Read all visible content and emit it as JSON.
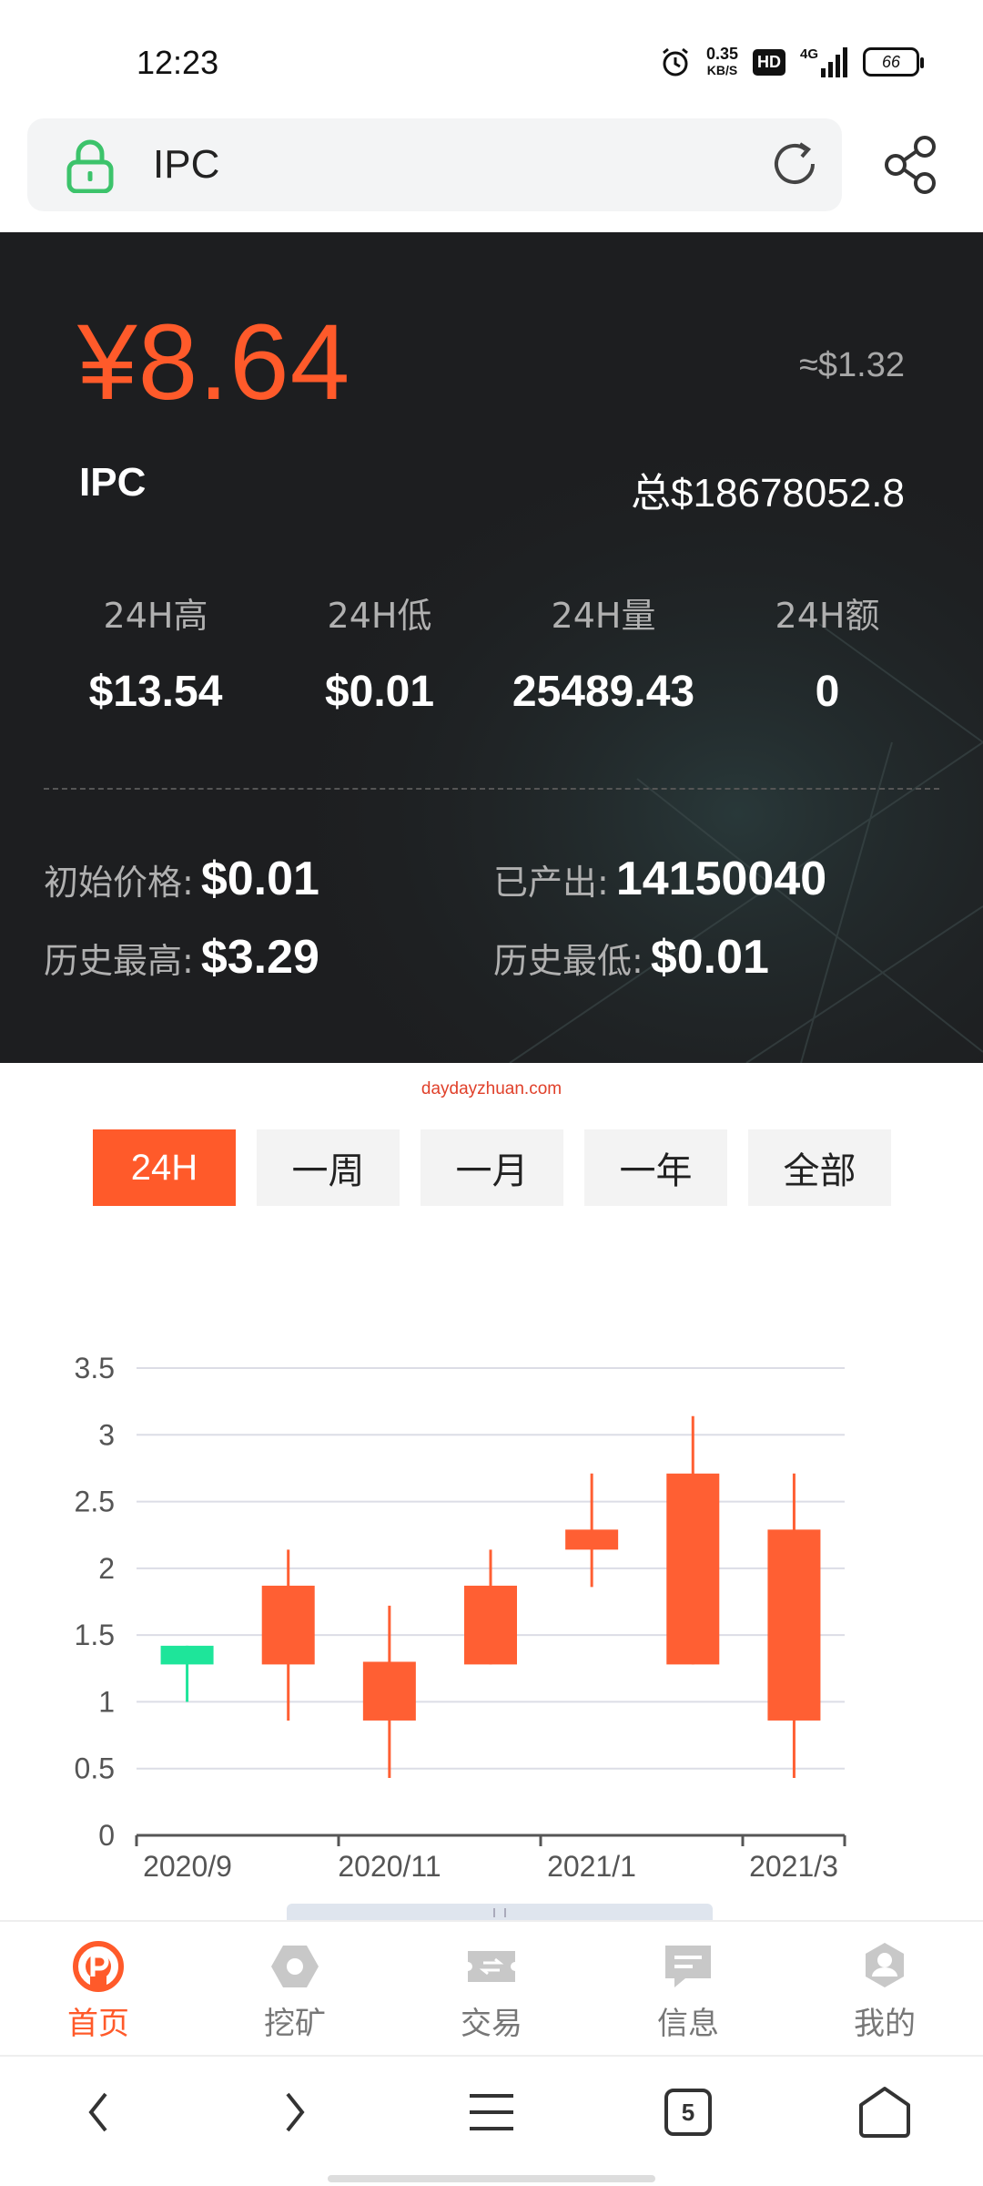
{
  "status_bar": {
    "time": "12:23",
    "net_speed_value": "0.35",
    "net_speed_unit": "KB/S",
    "hd_label": "HD",
    "network_label": "4G",
    "battery": "66"
  },
  "address_bar": {
    "text": "IPC"
  },
  "header": {
    "price_cny": "¥8.64",
    "price_usd": "≈$1.32",
    "coin_name": "IPC",
    "market_cap": "总$18678052.8",
    "stats": [
      {
        "label": "24H高",
        "value": "$13.54"
      },
      {
        "label": "24H低",
        "value": "$0.01"
      },
      {
        "label": "24H量",
        "value": "25489.43"
      },
      {
        "label": "24H额",
        "value": "0"
      }
    ],
    "info": [
      {
        "label": "初始价格:",
        "value": "$0.01"
      },
      {
        "label": "已产出:",
        "value": "14150040"
      },
      {
        "label": "历史最高:",
        "value": "$3.29"
      },
      {
        "label": "历史最低:",
        "value": "$0.01"
      }
    ]
  },
  "watermark": "daydayzhuan.com",
  "period_tabs": [
    {
      "label": "24H",
      "active": true
    },
    {
      "label": "一周",
      "active": false
    },
    {
      "label": "一月",
      "active": false
    },
    {
      "label": "一年",
      "active": false
    },
    {
      "label": "全部",
      "active": false
    }
  ],
  "chart_data": {
    "type": "candlestick",
    "ylim": [
      0,
      3.5
    ],
    "y_ticks": [
      "0",
      "0.5",
      "1",
      "1.5",
      "2",
      "2.5",
      "3",
      "3.5"
    ],
    "x_ticks": [
      "2020/9",
      "2020/11",
      "2021/1",
      "2021/3"
    ],
    "grid": true,
    "up_color": "#1ee59a",
    "down_color": "#ff5f33",
    "candles": [
      {
        "open": 1.28,
        "close": 1.42,
        "low": 1.0,
        "high": 1.42,
        "direction": "up"
      },
      {
        "open": 1.87,
        "close": 1.28,
        "low": 0.86,
        "high": 2.14,
        "direction": "down"
      },
      {
        "open": 1.3,
        "close": 0.86,
        "low": 0.43,
        "high": 1.72,
        "direction": "down"
      },
      {
        "open": 1.87,
        "close": 1.28,
        "low": 1.28,
        "high": 2.14,
        "direction": "down"
      },
      {
        "open": 2.29,
        "close": 2.14,
        "low": 1.86,
        "high": 2.71,
        "direction": "down"
      },
      {
        "open": 2.71,
        "close": 1.28,
        "low": 1.28,
        "high": 3.14,
        "direction": "down"
      },
      {
        "open": 2.29,
        "close": 0.86,
        "low": 0.43,
        "high": 2.71,
        "direction": "down"
      }
    ]
  },
  "bottom_nav": [
    {
      "label": "首页",
      "icon": "home-logo-icon",
      "active": true
    },
    {
      "label": "挖矿",
      "icon": "hexagon-icon",
      "active": false
    },
    {
      "label": "交易",
      "icon": "ticket-icon",
      "active": false
    },
    {
      "label": "信息",
      "icon": "message-icon",
      "active": false
    },
    {
      "label": "我的",
      "icon": "user-icon",
      "active": false
    }
  ],
  "browser_toolbar": {
    "tab_count": "5"
  },
  "colors": {
    "accent": "#ff5a2a",
    "dark_bg": "#1d1e20"
  }
}
